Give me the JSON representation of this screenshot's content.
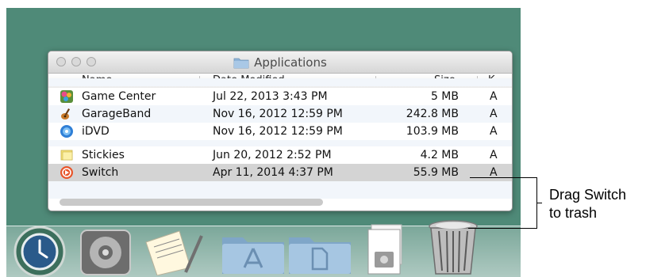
{
  "window": {
    "title": "Applications",
    "columns": {
      "name": "Name",
      "date": "Date Modified",
      "size": "Size",
      "kind": "K"
    },
    "rows": [
      {
        "icon": "game-center-icon",
        "name": "Game Center",
        "date": "Jul 22, 2013 3:43 PM",
        "size": "5 MB",
        "kind": "A",
        "selected": false
      },
      {
        "icon": "garageband-icon",
        "name": "GarageBand",
        "date": "Nov 16, 2012 12:59 PM",
        "size": "242.8 MB",
        "kind": "A",
        "selected": false
      },
      {
        "icon": "idvd-icon",
        "name": "iDVD",
        "date": "Nov 16, 2012 12:59 PM",
        "size": "103.9 MB",
        "kind": "A",
        "selected": false
      },
      {
        "icon": "stickies-icon",
        "name": "Stickies",
        "date": "Jun 20, 2012 2:52 PM",
        "size": "4.2 MB",
        "kind": "A",
        "selected": false
      },
      {
        "icon": "switch-icon",
        "name": "Switch",
        "date": "Apr 11, 2014 4:37 PM",
        "size": "55.9 MB",
        "kind": "A",
        "selected": true
      }
    ]
  },
  "dock": {
    "items": [
      "time-machine-icon",
      "system-preferences-icon",
      "textedit-icon",
      "applications-folder-icon",
      "documents-folder-icon",
      "downloads-stack-icon",
      "trash-icon"
    ]
  },
  "annotation": {
    "line1": "Drag Switch",
    "line2": "to trash"
  },
  "colors": {
    "desktop": "#4f8a78",
    "selection": "#d4d4d4",
    "stripe": "#f2f6fb"
  }
}
